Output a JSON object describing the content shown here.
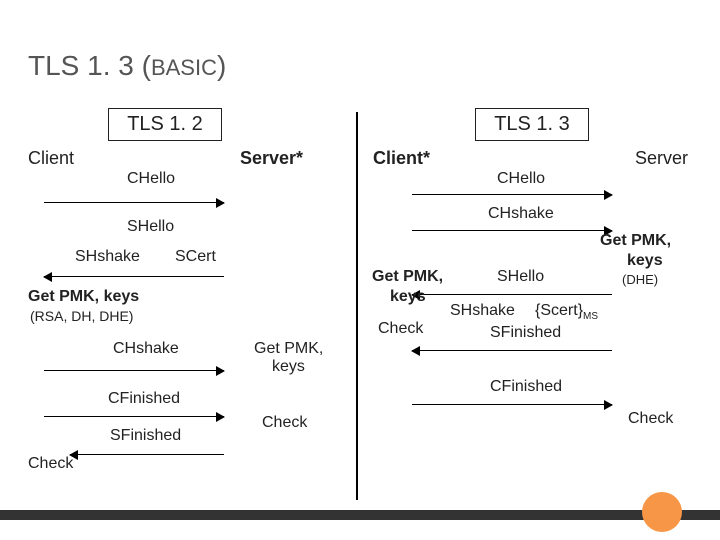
{
  "title": {
    "part1": "TLS 1. 3 (",
    "part2": "BASIC",
    "part3": ")"
  },
  "left": {
    "box_title": "TLS 1. 2",
    "client": "Client",
    "server": "Server*",
    "msgs": {
      "chello": "CHello",
      "shello": "SHello",
      "shshake": "SHshake",
      "scert": "SCert",
      "getpmk_keys": "Get PMK, keys",
      "getpmk_sub": "(RSA, DH, DHE)",
      "chshake": "CHshake",
      "cfinished": "CFinished",
      "sfinished": "SFinished",
      "check": "Check",
      "getpmk2": "Get PMK,",
      "getpmk2b": "keys",
      "check2": "Check"
    }
  },
  "right": {
    "box_title": "TLS 1. 3",
    "client": "Client*",
    "server": "Server",
    "msgs": {
      "chello": "CHello",
      "chshake": "CHshake",
      "getpmk": "Get PMK,",
      "getpmkb": "keys",
      "getpmk_dhe": "(DHE)",
      "shello": "SHello",
      "shshake": "SHshake",
      "scert_ms": "{Scert}",
      "scert_sub": "MS",
      "sfinished": "SFinished",
      "check": "Check",
      "cfinished": "CFinished",
      "check2": "Check",
      "l_getpmk": "Get PMK,",
      "l_getpmkb": "keys",
      "l_check": "Check"
    }
  }
}
